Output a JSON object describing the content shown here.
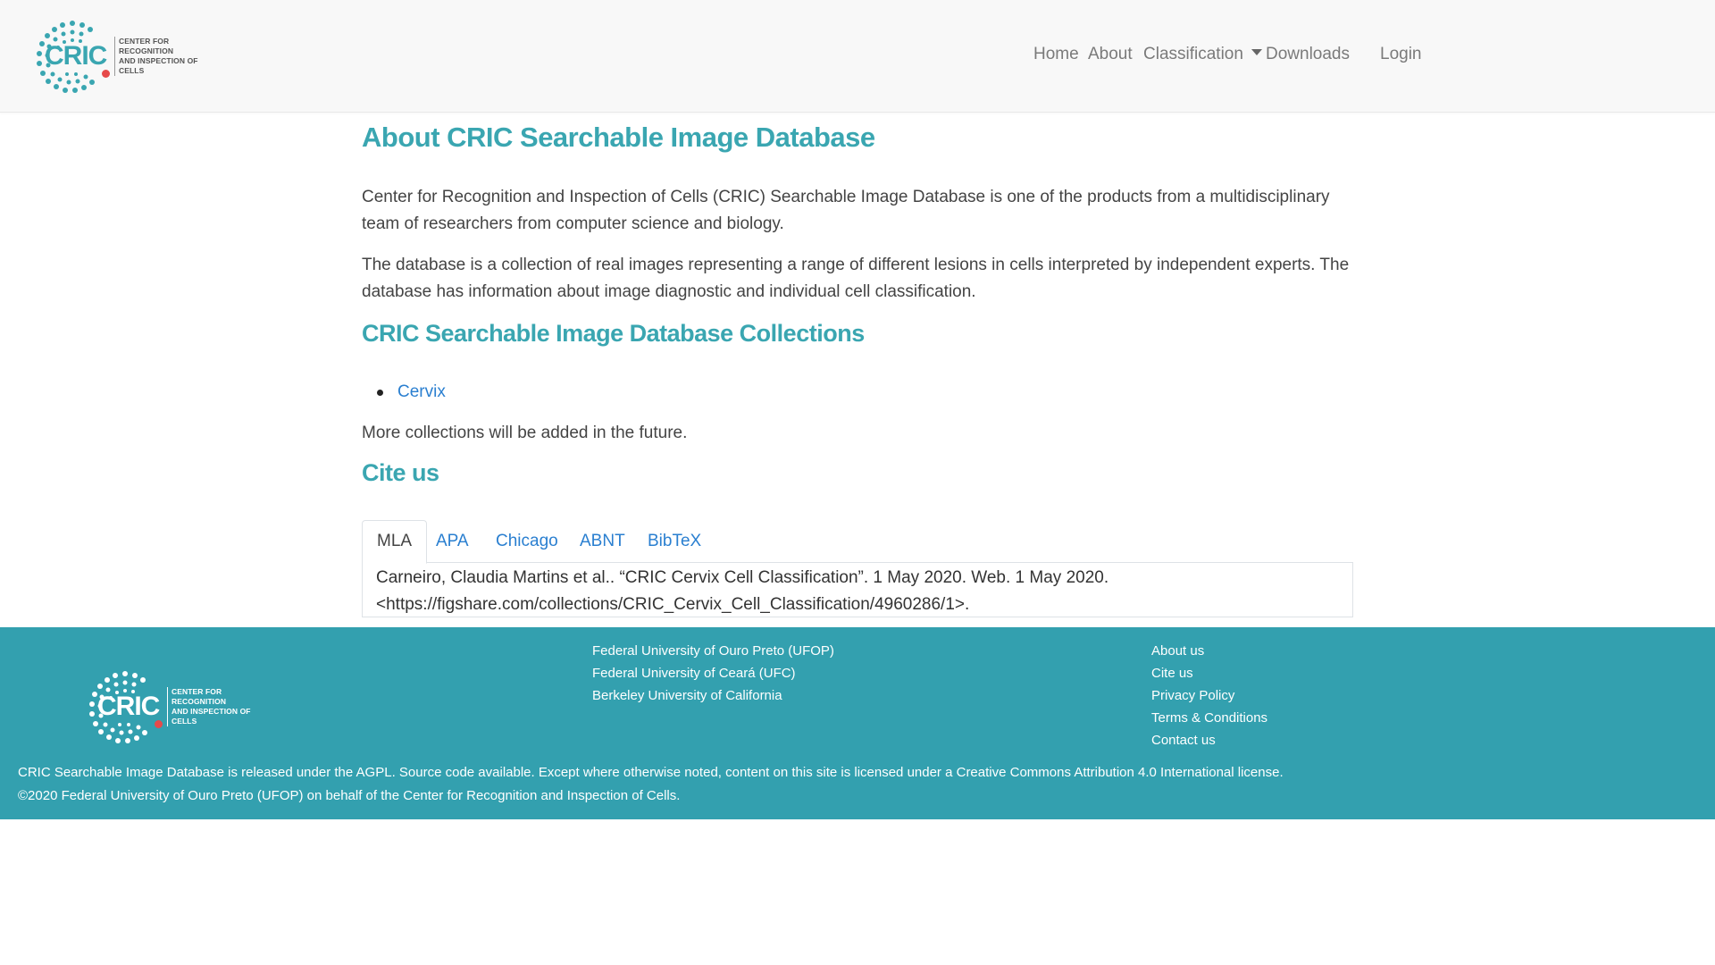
{
  "brand": {
    "wordmark": "CRIC",
    "subtitle_line1": "CENTER FOR RECOGNITION",
    "subtitle_line2": "AND INSPECTION OF CELLS"
  },
  "nav": {
    "items": [
      {
        "label": "Home"
      },
      {
        "label": "About"
      },
      {
        "label": "Classification"
      },
      {
        "label": "Downloads"
      },
      {
        "label": "Login"
      }
    ]
  },
  "main": {
    "title": "About CRIC Searchable Image Database",
    "para1": "Center for Recognition and Inspection of Cells (CRIC) Searchable Image Database is one of the products from a multidisciplinary team of researchers from computer science and biology.",
    "para2": "The database is a collection of real images representing a range of different lesions in cells interpreted by independent experts. The database has information about image diagnostic and individual cell classification.",
    "collections_heading": "CRIC Searchable Image Database Collections",
    "collections": [
      {
        "label": "Cervix"
      }
    ],
    "more_collections": "More collections will be added in the future.",
    "cite_heading": "Cite us",
    "cite_tabs": [
      {
        "label": "MLA",
        "active": true
      },
      {
        "label": "APA",
        "active": false
      },
      {
        "label": "Chicago",
        "active": false
      },
      {
        "label": "ABNT",
        "active": false
      },
      {
        "label": "BibTeX",
        "active": false
      }
    ],
    "cite_text_line1": "Carneiro, Claudia Martins et al.. “CRIC Cervix Cell Classification”. 1 May 2020. Web. 1 May 2020.",
    "cite_text_line2": "<https://figshare.com/collections/CRIC_Cervix_Cell_Classification/4960286/1>."
  },
  "footer": {
    "institutions": [
      {
        "label": "Federal University of Ouro Preto (UFOP)"
      },
      {
        "label": "Federal University of Ceará (UFC)"
      },
      {
        "label": "Berkeley University of California"
      }
    ],
    "links": [
      {
        "label": "About us"
      },
      {
        "label": "Cite us"
      },
      {
        "label": "Privacy Policy"
      },
      {
        "label": "Terms & Conditions"
      },
      {
        "label": "Contact us"
      }
    ],
    "license": "CRIC Searchable Image Database is released under the AGPL. Source code available. Except where otherwise noted, content on this site is licensed under a Creative Commons Attribution 4.0 International license.",
    "copyright": "©2020 Federal University of Ouro Preto (UFOP) on behalf of the Center for Recognition and Inspection of Cells."
  },
  "colors": {
    "accent": "#3aa6b1",
    "footer_bg": "#33a0af",
    "link": "#2a7fd0",
    "logo_dot": "#e64a4a"
  }
}
